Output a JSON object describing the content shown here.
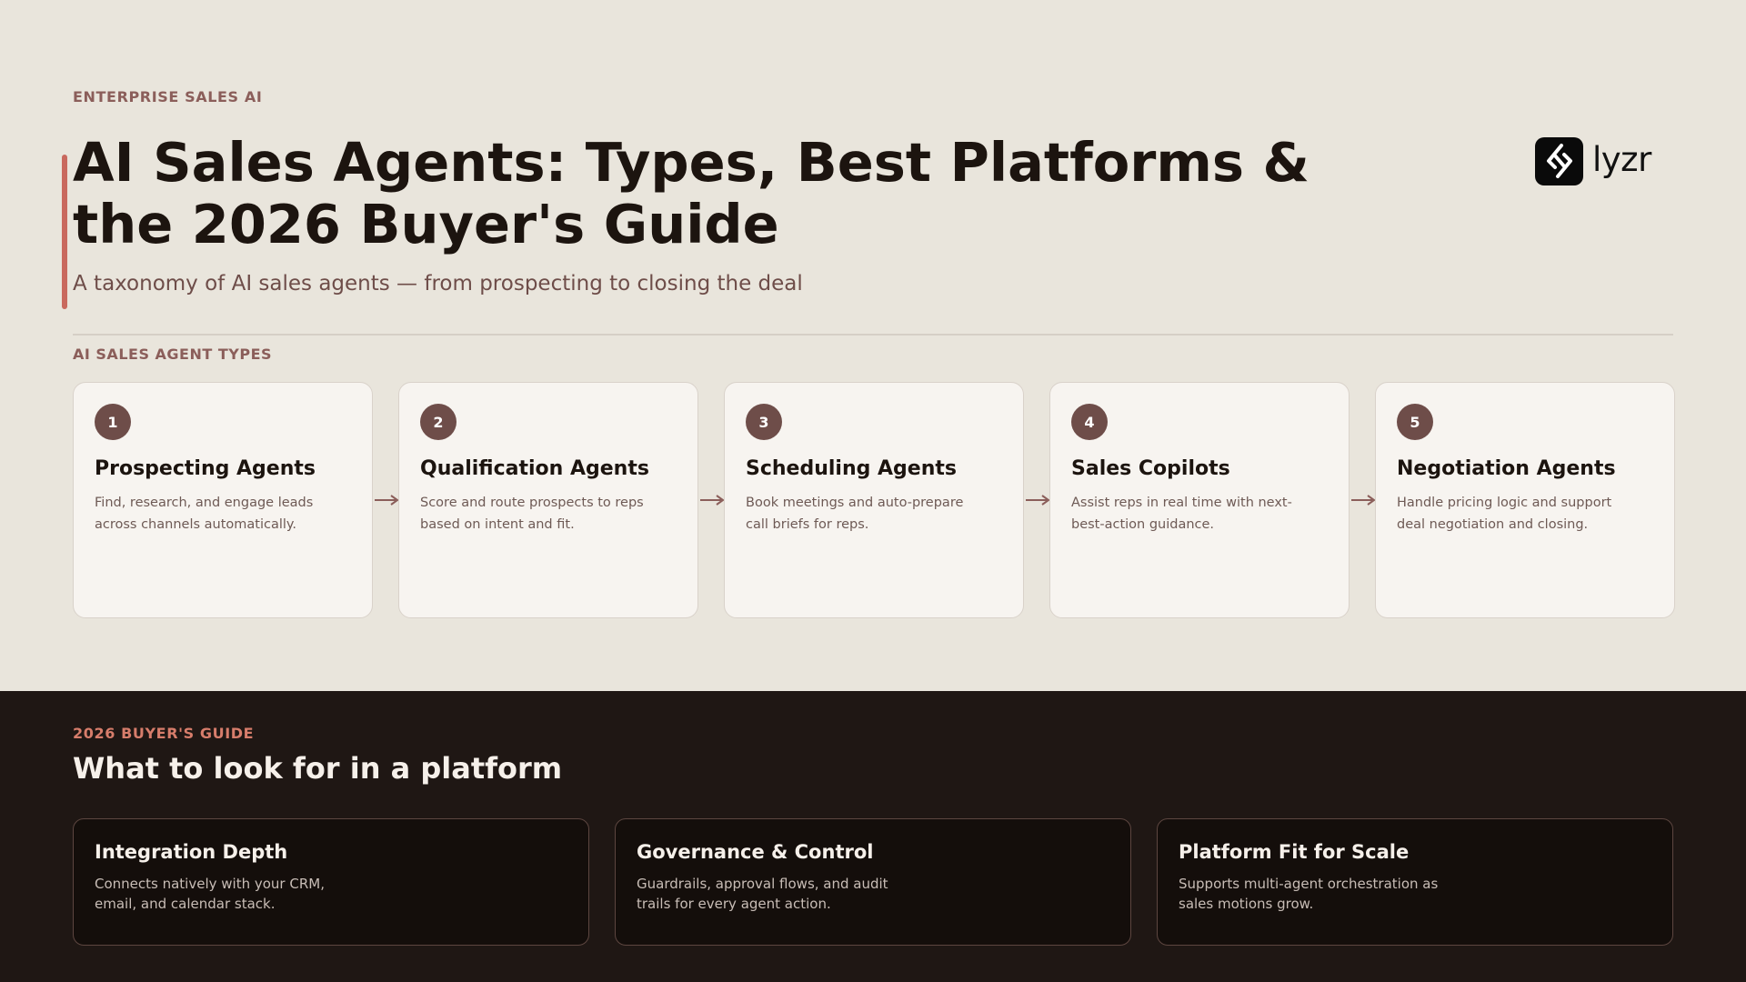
{
  "header": {
    "eyebrow": "ENTERPRISE SALES AI",
    "title": "AI Sales Agents: Types, Best Platforms & the 2026 Buyer's Guide",
    "subtitle": "A taxonomy of AI sales agents — from prospecting to closing the deal",
    "logo_text": "lyzr"
  },
  "types_section": {
    "label": "AI SALES AGENT TYPES",
    "cards": [
      {
        "number": "1",
        "title": "Prospecting Agents",
        "desc": "Find, research, and engage leads across channels automatically."
      },
      {
        "number": "2",
        "title": "Qualification Agents",
        "desc": "Score and route prospects to reps based on intent and fit."
      },
      {
        "number": "3",
        "title": "Scheduling Agents",
        "desc": "Book meetings and auto-prepare call briefs for reps."
      },
      {
        "number": "4",
        "title": "Sales Copilots",
        "desc": "Assist reps in real time with next-best-action guidance."
      },
      {
        "number": "5",
        "title": "Negotiation Agents",
        "desc": "Handle pricing logic and support deal negotiation and closing."
      }
    ]
  },
  "guide_section": {
    "eyebrow": "2026 BUYER'S GUIDE",
    "title": "What to look for in a platform",
    "cards": [
      {
        "title": "Integration Depth",
        "desc": "Connects natively with your CRM, email, and calendar stack."
      },
      {
        "title": "Governance & Control",
        "desc": "Guardrails, approval flows, and audit trails for every agent action."
      },
      {
        "title": "Platform Fit for Scale",
        "desc": "Supports multi-agent orchestration as sales motions grow."
      }
    ]
  },
  "colors": {
    "accent": "#c9695e",
    "badge": "#6e4d49",
    "dark_bg": "#1f1714",
    "light_bg": "#e9e5dc"
  }
}
